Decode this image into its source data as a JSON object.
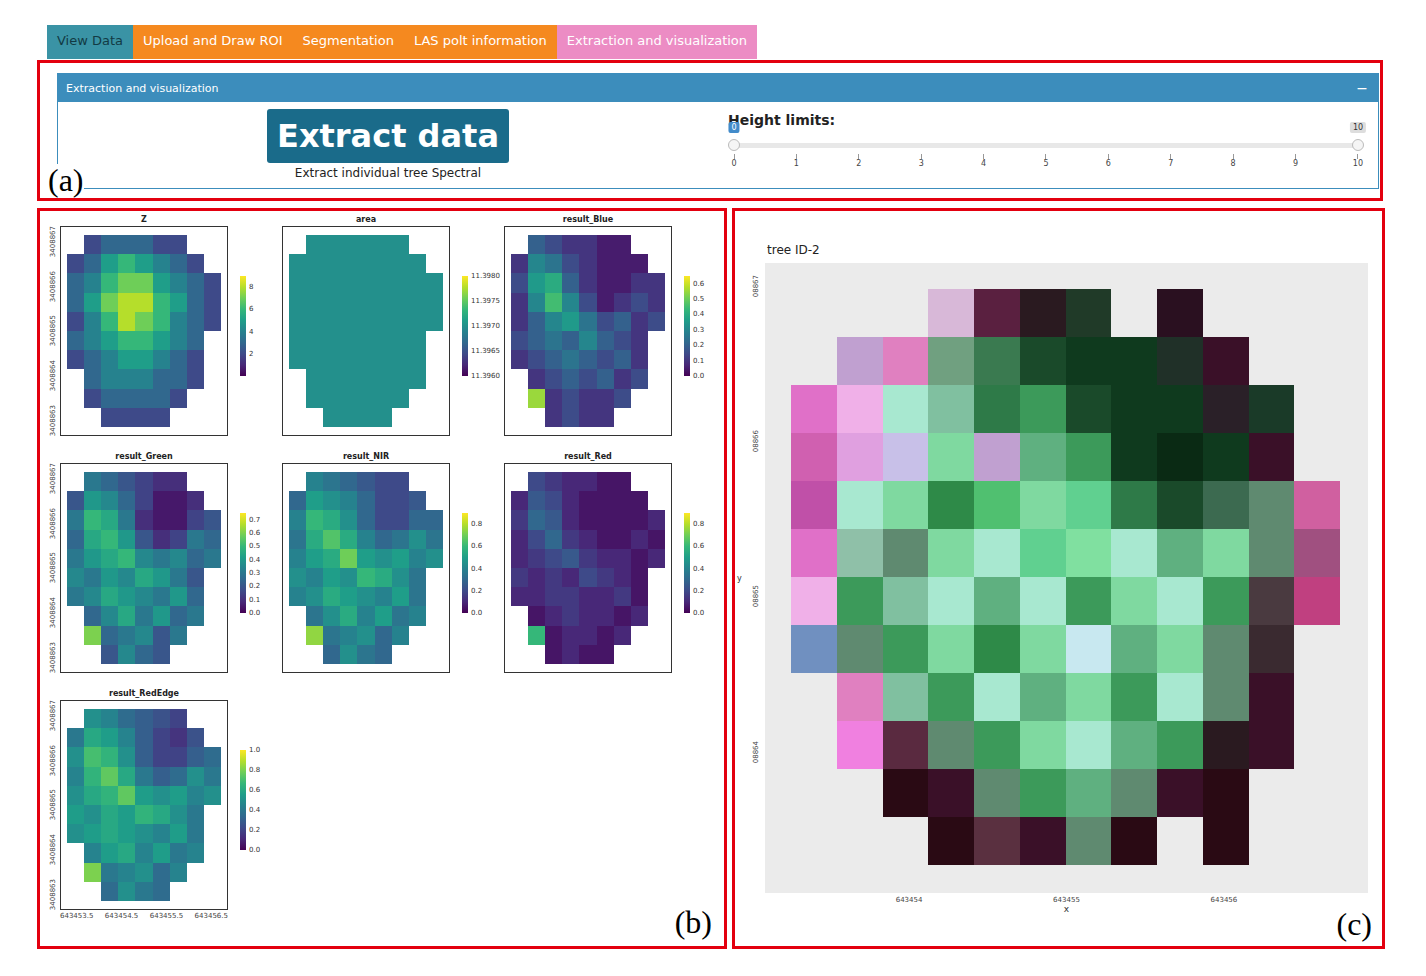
{
  "tabs": [
    {
      "label": "View Data",
      "selected": false,
      "color": "#3a93a5"
    },
    {
      "label": "Upload and Draw ROI",
      "selected": false,
      "color": "#f5891f"
    },
    {
      "label": "Segmentation",
      "selected": false,
      "color": "#f5891f"
    },
    {
      "label": "LAS polt information",
      "selected": false,
      "color": "#f5891f"
    },
    {
      "label": "Extraction and visualization",
      "selected": true,
      "color": "#ec8cc4"
    }
  ],
  "panel": {
    "label": "(a)",
    "title": "Extraction and visualization",
    "collapse": "−",
    "button": "Extract data",
    "caption": "Extract individual tree Spectral",
    "slider": {
      "label": "Height limits:",
      "ticks": [
        "0",
        "1",
        "2",
        "3",
        "4",
        "5",
        "6",
        "7",
        "8",
        "9",
        "10"
      ],
      "handles": [
        {
          "value": "0",
          "level": 0
        },
        {
          "value": "10",
          "level": 1
        }
      ]
    }
  },
  "band_plots": {
    "label": "(b)",
    "y_ticks": [
      "3408867",
      "3408866",
      "3408865",
      "3408864",
      "3408863"
    ],
    "x_ticks": [
      "643453.5",
      "643454.5",
      "643455.5",
      "643456.5"
    ],
    "plots": [
      {
        "title": "Z",
        "min": 0,
        "max": 9,
        "ticks": [
          "8",
          "6",
          "4",
          "2"
        ],
        "grid": [
          [
            null,
            2,
            3,
            3,
            3,
            2,
            2,
            null,
            null
          ],
          [
            2,
            3,
            5,
            6,
            5,
            4,
            3,
            2,
            null
          ],
          [
            3,
            4,
            6,
            7,
            7,
            5,
            4,
            3,
            2
          ],
          [
            3,
            5,
            7,
            8,
            8,
            6,
            5,
            3,
            2
          ],
          [
            2,
            4,
            6,
            8,
            7,
            6,
            4,
            3,
            2
          ],
          [
            3,
            4,
            5,
            6,
            6,
            5,
            4,
            3,
            null
          ],
          [
            2,
            3,
            4,
            5,
            5,
            4,
            3,
            2,
            null
          ],
          [
            null,
            3,
            4,
            4,
            4,
            3,
            3,
            2,
            null
          ],
          [
            null,
            2,
            3,
            3,
            3,
            3,
            2,
            null,
            null
          ],
          [
            null,
            null,
            2,
            2,
            2,
            2,
            null,
            null,
            null
          ]
        ]
      },
      {
        "title": "area",
        "min": 11.396,
        "max": 11.398,
        "ticks": [
          "11.3980",
          "11.3975",
          "11.3970",
          "11.3965",
          "11.3960"
        ],
        "grid": [
          [
            null,
            11.397,
            11.397,
            11.397,
            11.397,
            11.397,
            11.397,
            null,
            null
          ],
          [
            11.397,
            11.397,
            11.397,
            11.397,
            11.397,
            11.397,
            11.397,
            11.397,
            null
          ],
          [
            11.397,
            11.397,
            11.397,
            11.397,
            11.397,
            11.397,
            11.397,
            11.397,
            11.397
          ],
          [
            11.397,
            11.397,
            11.397,
            11.397,
            11.397,
            11.397,
            11.397,
            11.397,
            11.397
          ],
          [
            11.397,
            11.397,
            11.397,
            11.397,
            11.397,
            11.397,
            11.397,
            11.397,
            11.397
          ],
          [
            11.397,
            11.397,
            11.397,
            11.397,
            11.397,
            11.397,
            11.397,
            11.397,
            null
          ],
          [
            11.397,
            11.397,
            11.397,
            11.397,
            11.397,
            11.397,
            11.397,
            11.397,
            null
          ],
          [
            null,
            11.397,
            11.397,
            11.397,
            11.397,
            11.397,
            11.397,
            11.397,
            null
          ],
          [
            null,
            11.397,
            11.397,
            11.397,
            11.397,
            11.397,
            11.397,
            null,
            null
          ],
          [
            null,
            null,
            11.397,
            11.397,
            11.397,
            11.397,
            null,
            null,
            null
          ]
        ]
      },
      {
        "title": "result_Blue",
        "min": 0,
        "max": 0.65,
        "ticks": [
          "0.6",
          "0.5",
          "0.4",
          "0.3",
          "0.2",
          "0.1",
          "0.0"
        ],
        "grid": [
          [
            null,
            0.2,
            0.15,
            0.1,
            0.1,
            0.05,
            0.05,
            null,
            null
          ],
          [
            0.1,
            0.3,
            0.25,
            0.15,
            0.1,
            0.05,
            0.05,
            0.05,
            null
          ],
          [
            0.15,
            0.35,
            0.4,
            0.2,
            0.1,
            0.05,
            0.05,
            0.1,
            0.1
          ],
          [
            0.1,
            0.3,
            0.45,
            0.3,
            0.15,
            0.05,
            0.1,
            0.15,
            0.1
          ],
          [
            0.1,
            0.2,
            0.3,
            0.35,
            0.25,
            0.15,
            0.2,
            0.1,
            0.15
          ],
          [
            0.15,
            0.2,
            0.25,
            0.2,
            0.3,
            0.2,
            0.15,
            0.1,
            null
          ],
          [
            0.1,
            0.15,
            0.2,
            0.25,
            0.2,
            0.15,
            0.2,
            0.1,
            null
          ],
          [
            null,
            0.1,
            0.15,
            0.2,
            0.15,
            0.2,
            0.1,
            0.15,
            null
          ],
          [
            null,
            0.55,
            0.1,
            0.15,
            0.1,
            0.1,
            0.15,
            null,
            null
          ],
          [
            null,
            null,
            0.1,
            0.15,
            0.1,
            0.1,
            null,
            null,
            null
          ]
        ]
      },
      {
        "title": "result_Green",
        "min": 0,
        "max": 0.75,
        "ticks": [
          "0.7",
          "0.6",
          "0.5",
          "0.4",
          "0.3",
          "0.2",
          "0.1",
          "0.0"
        ],
        "grid": [
          [
            null,
            0.3,
            0.25,
            0.2,
            0.15,
            0.1,
            0.1,
            null,
            null
          ],
          [
            0.2,
            0.4,
            0.35,
            0.25,
            0.15,
            0.05,
            0.05,
            0.1,
            null
          ],
          [
            0.3,
            0.5,
            0.45,
            0.3,
            0.1,
            0.05,
            0.05,
            0.15,
            0.2
          ],
          [
            0.25,
            0.45,
            0.5,
            0.4,
            0.2,
            0.1,
            0.15,
            0.3,
            0.25
          ],
          [
            0.3,
            0.4,
            0.45,
            0.5,
            0.35,
            0.3,
            0.35,
            0.25,
            0.3
          ],
          [
            0.35,
            0.3,
            0.4,
            0.35,
            0.45,
            0.4,
            0.3,
            0.2,
            null
          ],
          [
            0.3,
            0.35,
            0.45,
            0.4,
            0.35,
            0.3,
            0.4,
            0.25,
            null
          ],
          [
            null,
            0.25,
            0.35,
            0.45,
            0.3,
            0.4,
            0.25,
            0.3,
            null
          ],
          [
            null,
            0.6,
            0.25,
            0.3,
            0.35,
            0.2,
            0.3,
            null,
            null
          ],
          [
            null,
            null,
            0.2,
            0.35,
            0.25,
            0.2,
            null,
            null,
            null
          ]
        ]
      },
      {
        "title": "result_NIR",
        "min": 0,
        "max": 0.9,
        "ticks": [
          "0.8",
          "0.6",
          "0.4",
          "0.2",
          "0.0"
        ],
        "grid": [
          [
            null,
            0.4,
            0.35,
            0.3,
            0.25,
            0.2,
            0.2,
            null,
            null
          ],
          [
            0.3,
            0.5,
            0.45,
            0.4,
            0.3,
            0.2,
            0.2,
            0.25,
            null
          ],
          [
            0.4,
            0.6,
            0.55,
            0.45,
            0.3,
            0.2,
            0.2,
            0.3,
            0.3
          ],
          [
            0.35,
            0.55,
            0.65,
            0.55,
            0.4,
            0.3,
            0.35,
            0.45,
            0.35
          ],
          [
            0.4,
            0.5,
            0.55,
            0.7,
            0.5,
            0.45,
            0.5,
            0.4,
            0.45
          ],
          [
            0.45,
            0.4,
            0.5,
            0.45,
            0.6,
            0.55,
            0.45,
            0.35,
            null
          ],
          [
            0.4,
            0.45,
            0.55,
            0.5,
            0.45,
            0.4,
            0.5,
            0.35,
            null
          ],
          [
            null,
            0.35,
            0.45,
            0.55,
            0.4,
            0.5,
            0.35,
            0.4,
            null
          ],
          [
            null,
            0.75,
            0.35,
            0.4,
            0.45,
            0.3,
            0.4,
            null,
            null
          ],
          [
            null,
            null,
            0.3,
            0.45,
            0.35,
            0.3,
            null,
            null,
            null
          ]
        ]
      },
      {
        "title": "result_Red",
        "min": 0,
        "max": 0.9,
        "ticks": [
          "0.8",
          "0.6",
          "0.4",
          "0.2",
          "0.0"
        ],
        "grid": [
          [
            null,
            0.2,
            0.15,
            0.1,
            0.1,
            0.05,
            0.05,
            null,
            null
          ],
          [
            0.1,
            0.25,
            0.2,
            0.1,
            0.05,
            0.05,
            0.05,
            0.05,
            null
          ],
          [
            0.15,
            0.3,
            0.25,
            0.1,
            0.05,
            0.05,
            0.05,
            0.05,
            0.1
          ],
          [
            0.1,
            0.2,
            0.3,
            0.15,
            0.1,
            0.05,
            0.05,
            0.1,
            0.05
          ],
          [
            0.1,
            0.15,
            0.2,
            0.25,
            0.15,
            0.1,
            0.1,
            0.05,
            0.1
          ],
          [
            0.15,
            0.1,
            0.15,
            0.1,
            0.2,
            0.15,
            0.1,
            0.05,
            null
          ],
          [
            0.1,
            0.1,
            0.15,
            0.15,
            0.1,
            0.1,
            0.15,
            0.05,
            null
          ],
          [
            null,
            0.05,
            0.1,
            0.15,
            0.1,
            0.1,
            0.05,
            0.1,
            null
          ],
          [
            null,
            0.6,
            0.05,
            0.1,
            0.1,
            0.05,
            0.1,
            null,
            null
          ],
          [
            null,
            null,
            0.05,
            0.1,
            0.05,
            0.05,
            null,
            null,
            null
          ]
        ]
      },
      {
        "title": "result_RedEdge",
        "min": 0,
        "max": 1.0,
        "ticks": [
          "1.0",
          "0.8",
          "0.6",
          "0.4",
          "0.2",
          "0.0"
        ],
        "grid": [
          [
            null,
            0.5,
            0.45,
            0.35,
            0.3,
            0.25,
            0.2,
            null,
            null
          ],
          [
            0.4,
            0.6,
            0.55,
            0.45,
            0.3,
            0.2,
            0.15,
            0.25,
            null
          ],
          [
            0.5,
            0.7,
            0.65,
            0.5,
            0.3,
            0.2,
            0.2,
            0.3,
            0.35
          ],
          [
            0.45,
            0.65,
            0.75,
            0.6,
            0.4,
            0.3,
            0.35,
            0.5,
            0.4
          ],
          [
            0.5,
            0.6,
            0.65,
            0.75,
            0.55,
            0.5,
            0.55,
            0.45,
            0.5
          ],
          [
            0.55,
            0.5,
            0.6,
            0.55,
            0.65,
            0.6,
            0.5,
            0.4,
            null
          ],
          [
            0.5,
            0.55,
            0.6,
            0.55,
            0.5,
            0.45,
            0.55,
            0.4,
            null
          ],
          [
            null,
            0.45,
            0.55,
            0.6,
            0.45,
            0.55,
            0.4,
            0.45,
            null
          ],
          [
            null,
            0.8,
            0.4,
            0.45,
            0.5,
            0.35,
            0.45,
            null,
            null
          ],
          [
            null,
            null,
            0.35,
            0.5,
            0.4,
            0.35,
            null,
            null,
            null
          ]
        ]
      }
    ]
  },
  "tree_view": {
    "label": "(c)",
    "title": "tree ID-2",
    "y_ticks": [
      "08867",
      "08866",
      "08865",
      "08864"
    ],
    "x_ticks": [
      "643454",
      "643455",
      "643456"
    ],
    "x_label": "x",
    "y_label": "y",
    "grid": [
      [
        null,
        null,
        null,
        "#d8b8d8",
        "#5a2040",
        "#2a1a20",
        "#203a28",
        null,
        "#2a1020",
        null,
        null,
        null
      ],
      [
        null,
        "#c0a0d0",
        "#e080c0",
        "#70a080",
        "#3a7a50",
        "#1a4a2a",
        "#0f3a1e",
        "#0f3a1e",
        "#203028",
        "#3a1028",
        null,
        null
      ],
      [
        "#e070c8",
        "#f0b0e8",
        "#a8e8d0",
        "#80c0a0",
        "#2e7a48",
        "#3c9a5a",
        "#1a4a2a",
        "#0f3a1e",
        "#0f3a1e",
        "#2a2028",
        "#1a3a28",
        null
      ],
      [
        "#d060b0",
        "#e0a0e0",
        "#c8c0e8",
        "#7fd9a0",
        "#c0a0d0",
        "#5fb080",
        "#3c9a5a",
        "#0f3a1e",
        "#0a2a14",
        "#0f3a1e",
        "#3a1028",
        null
      ],
      [
        "#c050a8",
        "#a8e8d0",
        "#7fd9a0",
        "#2e8a48",
        "#50c070",
        "#7fd9a0",
        "#60d090",
        "#2e7a48",
        "#1a4a2a",
        "#3c6a50",
        "#5f8a70",
        "#d060a0"
      ],
      [
        "#e070c8",
        "#8fc0a8",
        "#5f8a70",
        "#7fd9a0",
        "#a8e8d0",
        "#60d090",
        "#80e0a0",
        "#a8e8d0",
        "#5fb080",
        "#7fd9a0",
        "#5f8a70",
        "#a05080"
      ],
      [
        "#f0b0e8",
        "#3c9a5a",
        "#80c0a0",
        "#a8e8d0",
        "#5fb080",
        "#a8e8d0",
        "#3c9a5a",
        "#7fd9a0",
        "#a8e8d0",
        "#3c9a5a",
        "#4a3a40",
        "#c04080"
      ],
      [
        "#7090c0",
        "#5f8a70",
        "#3c9a5a",
        "#7fd9a0",
        "#2e8a48",
        "#7fd9a0",
        "#c8e8f0",
        "#5fb080",
        "#7fd9a0",
        "#5f8a70",
        "#3a2a30",
        null
      ],
      [
        null,
        "#e080c0",
        "#80c0a0",
        "#3c9a5a",
        "#a8e8d0",
        "#5fb080",
        "#7fd9a0",
        "#3c9a5a",
        "#a8e8d0",
        "#5f8a70",
        "#3a1028",
        null
      ],
      [
        null,
        "#f080e0",
        "#5a2a40",
        "#5f8a70",
        "#3c9a5a",
        "#7fd9a0",
        "#a8e8d0",
        "#5fb080",
        "#3c9a5a",
        "#2a1a20",
        "#3a1028",
        null
      ],
      [
        null,
        null,
        "#2a0a14",
        "#3a1028",
        "#5f8a70",
        "#3c9a5a",
        "#5fb080",
        "#5f8a70",
        "#3a1028",
        "#2a0a14",
        null,
        null
      ],
      [
        null,
        null,
        null,
        "#2a0a14",
        "#5a3040",
        "#3a1028",
        "#5f8a70",
        "#2a0a14",
        null,
        "#2a0a14",
        null,
        null
      ]
    ]
  }
}
